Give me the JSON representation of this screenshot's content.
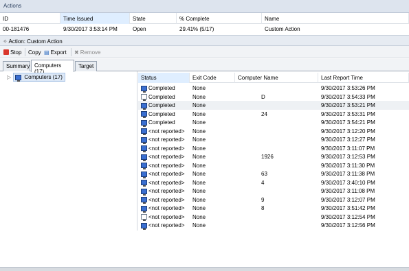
{
  "actions_pane": {
    "title": "Actions",
    "columns": [
      "ID",
      "Time Issued",
      "State",
      "% Complete",
      "Name"
    ],
    "row": {
      "id": "00-181476",
      "time_issued": "9/30/2017 3:53:14 PM",
      "state": "Open",
      "complete": "29.41% (5/17)",
      "name": "Custom Action"
    }
  },
  "action_detail": {
    "title": "Action: Custom Action"
  },
  "toolbar": {
    "stop": "Stop",
    "copy": "Copy",
    "export": "Export",
    "remove": "Remove"
  },
  "tabs": [
    "Summary",
    "Computers (17)",
    "Target"
  ],
  "tree": {
    "root": "Computers (17)"
  },
  "grid": {
    "columns": [
      "Status",
      "Exit Code",
      "Computer Name",
      "Last Report Time"
    ],
    "rows": [
      {
        "status": "Completed",
        "exit": "None",
        "name": "",
        "time": "9/30/2017 3:53:26 PM",
        "icon": "computer-icon"
      },
      {
        "status": "Completed",
        "exit": "None",
        "name": "D",
        "time": "9/30/2017 3:54:33 PM",
        "icon": "document-icon"
      },
      {
        "status": "Completed",
        "exit": "None",
        "name": "",
        "time": "9/30/2017 3:53:21 PM",
        "icon": "computer-icon"
      },
      {
        "status": "Completed",
        "exit": "None",
        "name": "24",
        "time": "9/30/2017 3:53:31 PM",
        "icon": "computer-icon"
      },
      {
        "status": "Completed",
        "exit": "None",
        "name": "",
        "time": "9/30/2017 3:54:21 PM",
        "icon": "computer-icon"
      },
      {
        "status": "<not reported>",
        "exit": "None",
        "name": "",
        "time": "9/30/2017 3:12:20 PM",
        "icon": "computer-icon"
      },
      {
        "status": "<not reported>",
        "exit": "None",
        "name": "",
        "time": "9/30/2017 3:12:27 PM",
        "icon": "computer-icon"
      },
      {
        "status": "<not reported>",
        "exit": "None",
        "name": "",
        "time": "9/30/2017 3:11:07 PM",
        "icon": "computer-icon"
      },
      {
        "status": "<not reported>",
        "exit": "None",
        "name": "1926",
        "time": "9/30/2017 3:12:53 PM",
        "icon": "computer-icon"
      },
      {
        "status": "<not reported>",
        "exit": "None",
        "name": "",
        "time": "9/30/2017 3:11:30 PM",
        "icon": "computer-icon"
      },
      {
        "status": "<not reported>",
        "exit": "None",
        "name": "63",
        "time": "9/30/2017 3:11:38 PM",
        "icon": "computer-icon"
      },
      {
        "status": "<not reported>",
        "exit": "None",
        "name": "4",
        "time": "9/30/2017 3:40:10 PM",
        "icon": "computer-icon"
      },
      {
        "status": "<not reported>",
        "exit": "None",
        "name": "",
        "time": "9/30/2017 3:11:08 PM",
        "icon": "computer-icon"
      },
      {
        "status": "<not reported>",
        "exit": "None",
        "name": "9",
        "time": "9/30/2017 3:12:07 PM",
        "icon": "computer-icon"
      },
      {
        "status": "<not reported>",
        "exit": "None",
        "name": "8",
        "time": "9/30/2017 3:51:42 PM",
        "icon": "computer-icon"
      },
      {
        "status": "<not reported>",
        "exit": "None",
        "name": "",
        "time": "9/30/2017 3:12:54 PM",
        "icon": "document-icon"
      },
      {
        "status": "<not reported>",
        "exit": "None",
        "name": "",
        "time": "9/30/2017 3:12:56 PM",
        "icon": "computer-icon"
      }
    ]
  },
  "colors": {
    "header_bg": "#dde4ee",
    "sorted_bg": "#dfeeff",
    "icon_blue": "#3a6fd1"
  }
}
